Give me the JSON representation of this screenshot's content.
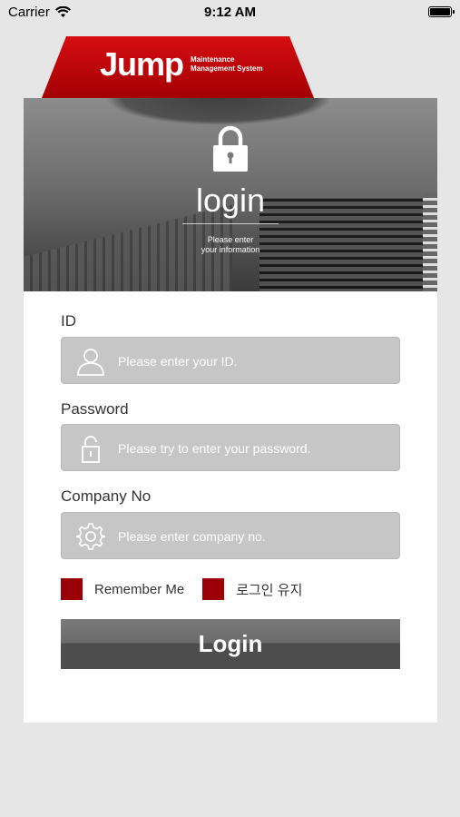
{
  "status_bar": {
    "carrier": "Carrier",
    "time": "9:12 AM"
  },
  "header": {
    "logo_main": "Jump",
    "logo_sub_line1": "Maintenance",
    "logo_sub_line2": "Management System"
  },
  "hero": {
    "title": "login",
    "subtitle": "Please enter\nyour information"
  },
  "form": {
    "id_label": "ID",
    "id_placeholder": "Please enter your ID.",
    "password_label": "Password",
    "password_placeholder": "Please try to enter your password.",
    "company_label": "Company No",
    "company_placeholder": "Please enter company no.",
    "remember_label": "Remember Me",
    "keep_login_label": "로그인 유지",
    "login_button": "Login"
  },
  "colors": {
    "brand_red": "#c0060b",
    "checkbox": "#9b0008",
    "field_bg": "#c6c6c6"
  },
  "icons": [
    "wifi-icon",
    "battery-icon",
    "lock-icon",
    "user-icon",
    "unlock-icon",
    "gear-icon"
  ]
}
